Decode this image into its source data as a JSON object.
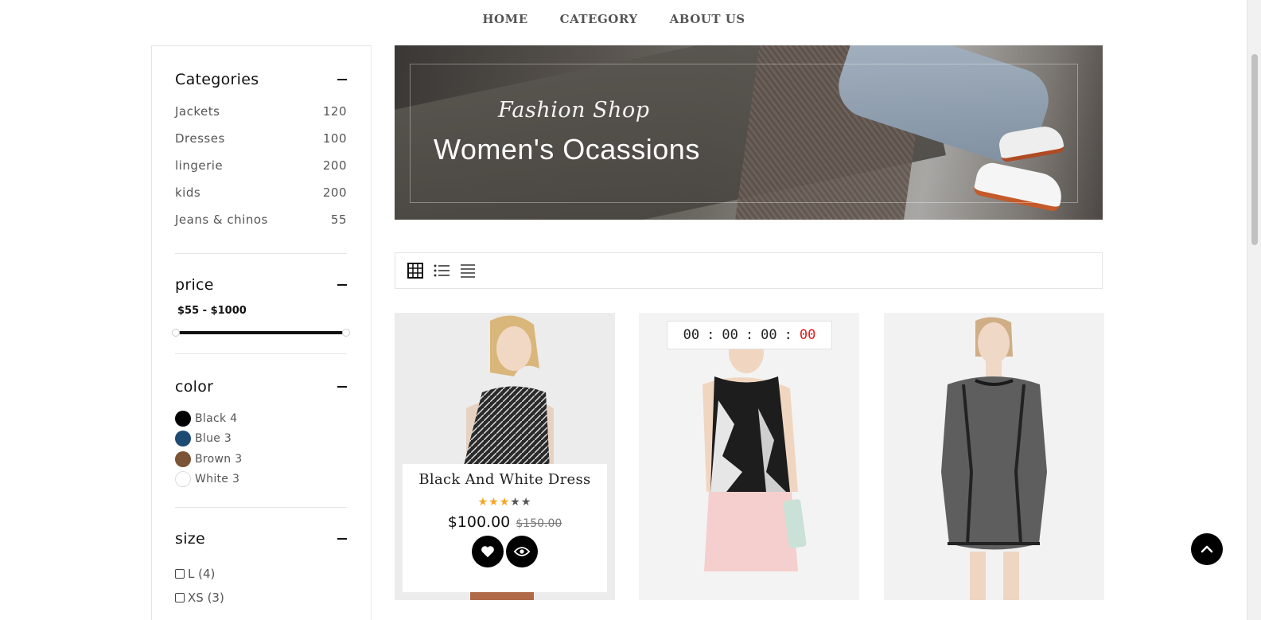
{
  "nav": {
    "items": [
      "HOME",
      "CATEGORY",
      "ABOUT US"
    ]
  },
  "sidebar": {
    "categories": {
      "title": "Categories",
      "items": [
        {
          "label": "Jackets",
          "count": "120"
        },
        {
          "label": "Dresses",
          "count": "100"
        },
        {
          "label": "lingerie",
          "count": "200"
        },
        {
          "label": "kids",
          "count": "200"
        },
        {
          "label": "Jeans & chinos",
          "count": "55"
        }
      ]
    },
    "price": {
      "title": "price",
      "range": "$55 - $1000",
      "min": 55,
      "max": 1000
    },
    "color": {
      "title": "color",
      "items": [
        {
          "label": "Black 4",
          "hex": "#000000"
        },
        {
          "label": "Blue 3",
          "hex": "#1d4a72"
        },
        {
          "label": "Brown 3",
          "hex": "#7a5434"
        },
        {
          "label": "White 3",
          "hex": "#ffffff"
        }
      ]
    },
    "size": {
      "title": "size",
      "items": [
        "L (4)",
        "XS (3)"
      ]
    }
  },
  "banner": {
    "script": "Fashion Shop",
    "headline": "Women's  Ocassions"
  },
  "toolbar": {
    "views": [
      "grid-view-icon",
      "list-view-icon",
      "compact-list-icon"
    ]
  },
  "products": [
    {
      "name": "Black And White Dress",
      "rating": 3,
      "rating_max": 5,
      "price": "$100.00",
      "old_price": "$150.00"
    },
    {
      "timer": {
        "days": "00",
        "hours": "00",
        "minutes": "00",
        "seconds": "00"
      }
    },
    {}
  ],
  "colors": {
    "accent": "#000000",
    "star": "#f5a623",
    "timer_seconds": "#e31b1b"
  }
}
